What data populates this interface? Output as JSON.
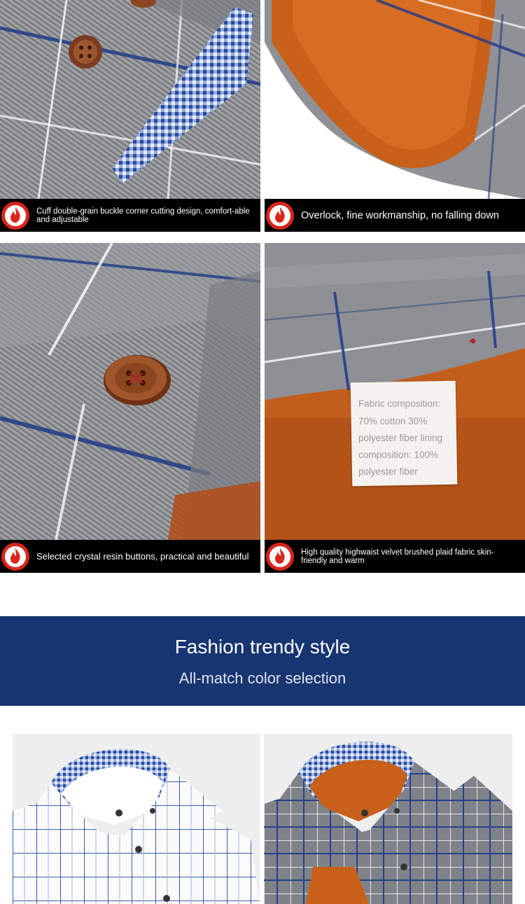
{
  "panels": [
    {
      "caption": "Cuff double-grain buckle corner cutting design, comfort-able and adjustable",
      "icon": "fire-icon"
    },
    {
      "caption": "Overlock, fine workmanship, no falling down",
      "icon": "fire-icon"
    },
    {
      "caption": "Selected crystal resin buttons, practical and beautiful",
      "icon": "fire-icon"
    },
    {
      "caption": "High quality highwaist velvet brushed plaid fabric skin-friendly and warm",
      "icon": "fire-icon"
    }
  ],
  "tag": {
    "lines": [
      "Fabric composition:",
      "70% cotton 30%",
      "polyester fiber lining",
      "composition: 100%",
      "polyester fiber"
    ]
  },
  "banner": {
    "title": "Fashion trendy style",
    "subtitle": "All-match color selection"
  },
  "colors": {
    "banner_bg": "#173570",
    "icon_red": "#d9251c",
    "lining_orange": "#c8601a",
    "plaid_blue": "#24408a"
  }
}
